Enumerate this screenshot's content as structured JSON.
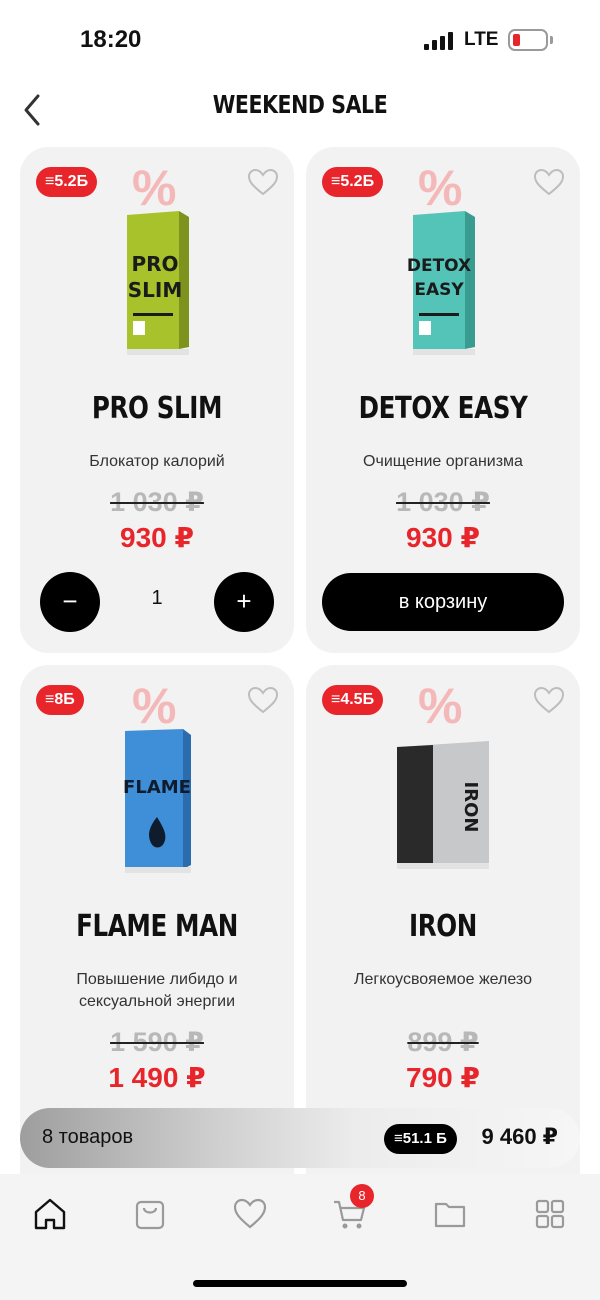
{
  "status_bar": {
    "time": "18:20",
    "network": "LTE",
    "battery_color": "#e8252a"
  },
  "header": {
    "title": "WEEKEND SALE",
    "back_icon": "chevron-left-icon"
  },
  "products": [
    {
      "bonus": "≡5.2Б",
      "name": "PRO SLIM",
      "description": "Блокатор калорий",
      "old_price": "1 030 ₽",
      "new_price": "930 ₽",
      "box_label": [
        "PRO",
        "SLIM"
      ],
      "box_color": "#b6d22f",
      "quantity": "1"
    },
    {
      "bonus": "≡5.2Б",
      "name": "DETOX EASY",
      "description": "Очищение организма",
      "old_price": "1 030 ₽",
      "new_price": "930 ₽",
      "box_label": [
        "DETOX",
        "EASY"
      ],
      "box_color": "#5ccfc3",
      "action_label": "в корзину"
    },
    {
      "bonus": "≡8Б",
      "name": "FLAME MAN",
      "description": "Повышение либидо и сексуальной энергии",
      "old_price": "1 590 ₽",
      "new_price": "1 490 ₽",
      "box_label": [
        "FLAME"
      ],
      "box_color": "#3f8fd8"
    },
    {
      "bonus": "≡4.5Б",
      "name": "IRON",
      "description": "Легкоусвояемое железо",
      "old_price": "899 ₽",
      "new_price": "790 ₽",
      "box_label": [
        "IRON"
      ],
      "box_color": "#c9cbcd"
    }
  ],
  "percent_mark": "%",
  "cart_bar": {
    "count_label": "8 товаров",
    "bonus": "≡51.1 Б",
    "total": "9 460 ₽"
  },
  "tab_bar": {
    "items": [
      "home-icon",
      "bag-icon",
      "heart-icon",
      "cart-icon",
      "folder-icon",
      "grid-icon"
    ],
    "cart_badge": "8"
  },
  "colors": {
    "accent": "#e8252a",
    "card_bg": "#f2f2f2",
    "button_bg": "#000000"
  }
}
